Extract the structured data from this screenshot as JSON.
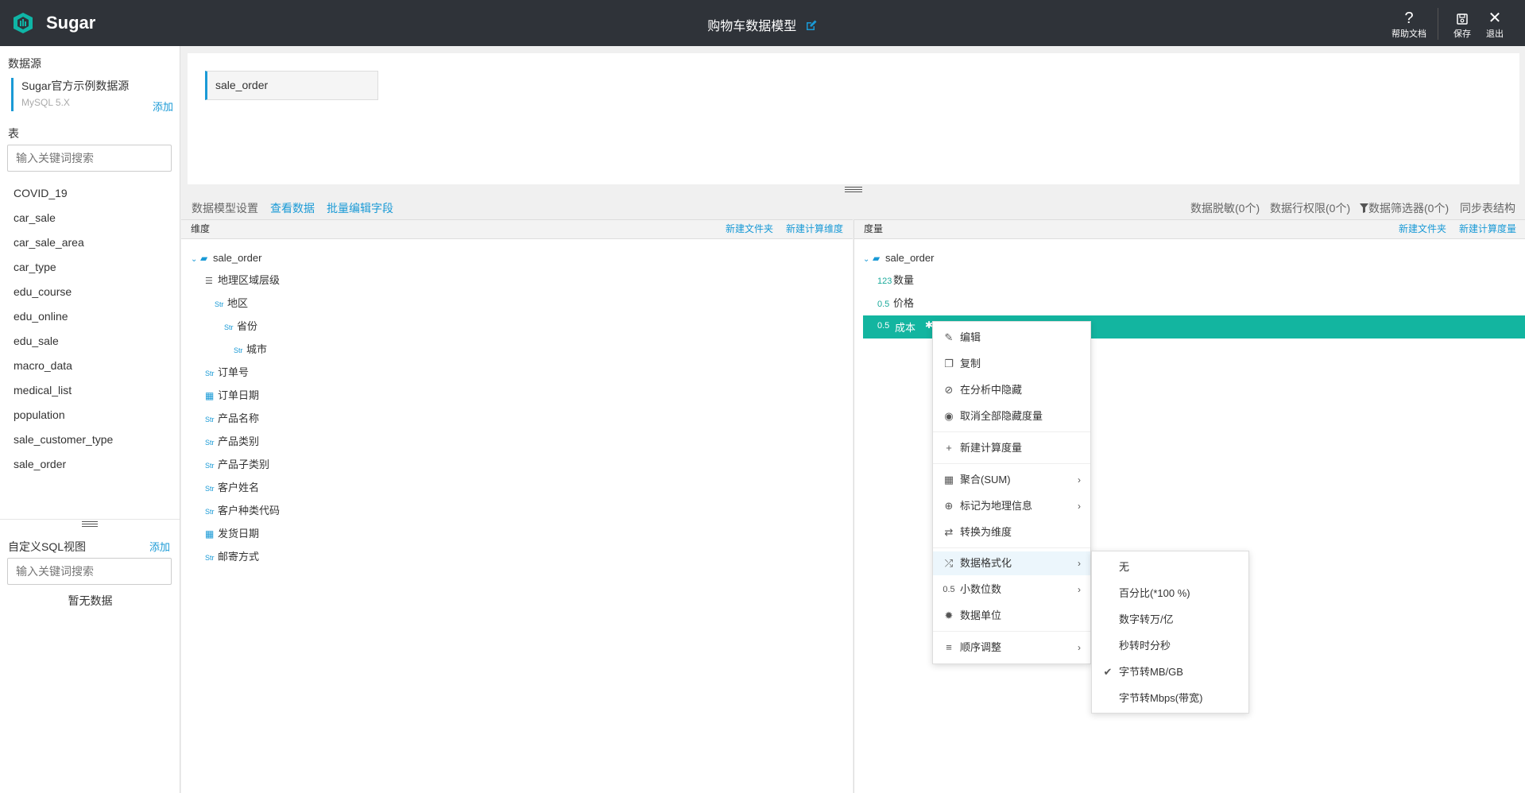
{
  "header": {
    "brand": "Sugar",
    "title": "购物车数据模型",
    "help_label": "帮助文档",
    "save_label": "保存",
    "exit_label": "退出"
  },
  "sidebar": {
    "datasource_heading": "数据源",
    "datasource_name": "Sugar官方示例数据源",
    "datasource_type": "MySQL 5.X",
    "add_label": "添加",
    "tables_heading": "表",
    "search_placeholder": "输入关键词搜索",
    "tables": [
      "COVID_19",
      "car_sale",
      "car_sale_area",
      "car_type",
      "edu_course",
      "edu_online",
      "edu_sale",
      "macro_data",
      "medical_list",
      "population",
      "sale_customer_type",
      "sale_order"
    ],
    "sql_heading": "自定义SQL视图",
    "sql_add_label": "添加",
    "sql_search_placeholder": "输入关键词搜索",
    "no_data": "暂无数据"
  },
  "canvas": {
    "table_name": "sale_order"
  },
  "tabs": {
    "settings": "数据模型设置",
    "view_data": "查看数据",
    "batch_edit": "批量编辑字段",
    "masking": "数据脱敏(0个)",
    "row_perm": "数据行权限(0个)",
    "filters": "数据筛选器(0个)",
    "sync": "同步表结构"
  },
  "dimension_panel": {
    "heading": "维度",
    "new_folder": "新建文件夹",
    "new_calc": "新建计算维度",
    "folder": "sale_order",
    "hierarchy": "地理区域层级",
    "items": [
      {
        "type": "Str",
        "name": "地区"
      },
      {
        "type": "Str",
        "name": "省份"
      },
      {
        "type": "Str",
        "name": "城市"
      },
      {
        "type": "Str",
        "name": "订单号"
      },
      {
        "type": "Date",
        "name": "订单日期"
      },
      {
        "type": "Str",
        "name": "产品名称"
      },
      {
        "type": "Str",
        "name": "产品类别"
      },
      {
        "type": "Str",
        "name": "产品子类别"
      },
      {
        "type": "Str",
        "name": "客户姓名"
      },
      {
        "type": "Str",
        "name": "客户种类代码"
      },
      {
        "type": "Date",
        "name": "发货日期"
      },
      {
        "type": "Str",
        "name": "邮寄方式"
      }
    ],
    "type_str": "Str"
  },
  "measure_panel": {
    "heading": "度量",
    "new_folder": "新建文件夹",
    "new_calc": "新建计算度量",
    "folder": "sale_order",
    "items": [
      {
        "type": "123",
        "name": "数量"
      },
      {
        "type": "0.5",
        "name": "价格"
      },
      {
        "type": "0.5",
        "name": "成本"
      }
    ]
  },
  "context_menu": {
    "items": [
      {
        "icon": "edit-icon",
        "label": "编辑"
      },
      {
        "icon": "copy-icon",
        "label": "复制"
      },
      {
        "icon": "eye-slash-icon",
        "label": "在分析中隐藏"
      },
      {
        "icon": "eye-icon",
        "label": "取消全部隐藏度量"
      },
      {
        "icon": "plus-icon",
        "label": "新建计算度量"
      },
      {
        "icon": "calculator-icon",
        "label": "聚合(SUM)"
      },
      {
        "icon": "globe-icon",
        "label": "标记为地理信息"
      },
      {
        "icon": "exchange-icon",
        "label": "转换为维度"
      },
      {
        "icon": "shuffle-icon",
        "label": "数据格式化"
      },
      {
        "icon": "decimal-icon",
        "label": "小数位数",
        "icon_text": "0.5"
      },
      {
        "icon": "gear-icon",
        "label": "数据单位"
      },
      {
        "icon": "list-icon",
        "label": "顺序调整"
      }
    ]
  },
  "format_submenu": {
    "items": [
      "无",
      "百分比(*100 %)",
      "数字转万/亿",
      "秒转时分秒",
      "字节转MB/GB",
      "字节转Mbps(带宽)"
    ],
    "checked_index": 4
  },
  "colors": {
    "topbar": "#2f3339",
    "accent": "#1a9ad6",
    "selection": "#13b5a0"
  }
}
